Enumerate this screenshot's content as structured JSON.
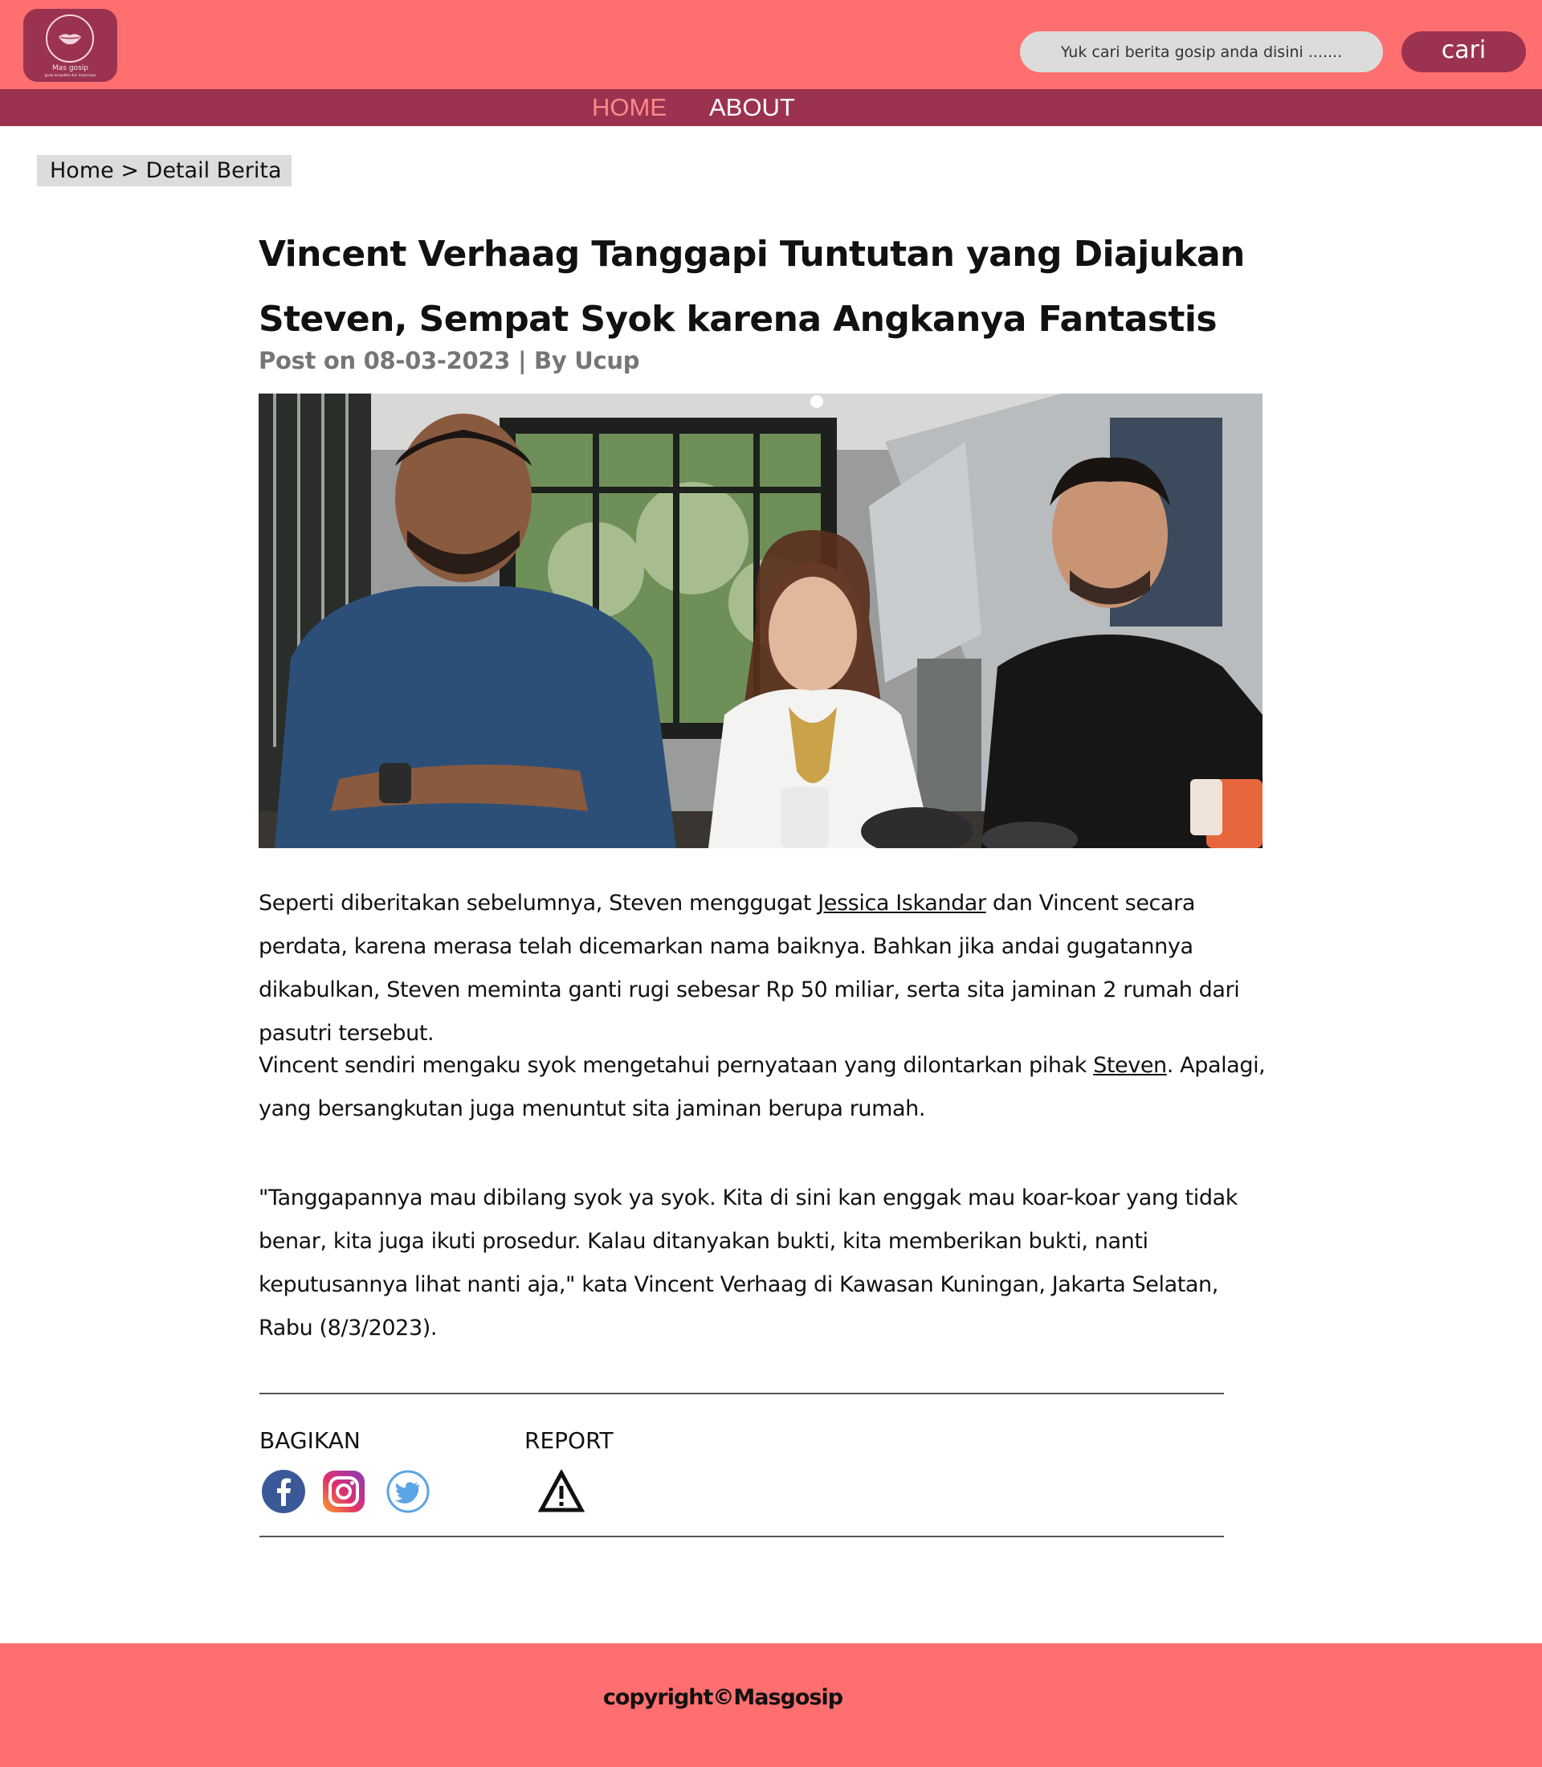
{
  "brand": {
    "name": "Mas gosip",
    "tagline": "gosip terupdate dan terpercaya",
    "colors": {
      "header": "#ff6f6f",
      "nav": "#9b3350",
      "accent_active": "#ff8888"
    }
  },
  "search": {
    "placeholder": "Yuk cari berita gosip anda disini .......",
    "button_label": "cari"
  },
  "nav": {
    "items": [
      {
        "label": "HOME",
        "active": true
      },
      {
        "label": "ABOUT",
        "active": false
      }
    ]
  },
  "breadcrumb": {
    "home": "Home",
    "separator": " > ",
    "current": "Detail Berita"
  },
  "article": {
    "title": "Vincent Verhaag Tanggapi Tuntutan yang Diajukan  Steven, Sempat Syok karena Angkanya Fantastis",
    "meta": "Post on 08-03-2023 | By Ucup",
    "p1": {
      "before": "Seperti diberitakan sebelumnya, Steven menggugat ",
      "link": "Jessica Iskandar",
      "after": " dan Vincent secara perdata, karena merasa telah dicemarkan nama baiknya. Bahkan jika andai gugatannya dikabulkan, Steven meminta ganti rugi sebesar Rp 50 miliar, serta sita jaminan 2 rumah dari pasutri tersebut."
    },
    "p2": {
      "before": "Vincent sendiri mengaku syok mengetahui pernyataan yang dilontarkan pihak ",
      "link": "Steven",
      "after": ". Apalagi, yang bersangkutan juga menuntut sita jaminan berupa rumah."
    },
    "p3": "\"Tanggapannya mau dibilang syok ya syok. Kita di sini kan enggak mau koar-koar yang tidak benar, kita juga ikuti prosedur. Kalau ditanyakan bukti, kita memberikan bukti, nanti keputusannya lihat nanti aja,\" kata Vincent Verhaag di Kawasan Kuningan, Jakarta Selatan, Rabu (8/3/2023)."
  },
  "share": {
    "label": "BAGIKAN",
    "icons": [
      "facebook-icon",
      "instagram-icon",
      "twitter-icon"
    ]
  },
  "report": {
    "label": "REPORT",
    "icon": "warning-icon"
  },
  "footer": {
    "copyright": "copyright©Masgosip"
  }
}
